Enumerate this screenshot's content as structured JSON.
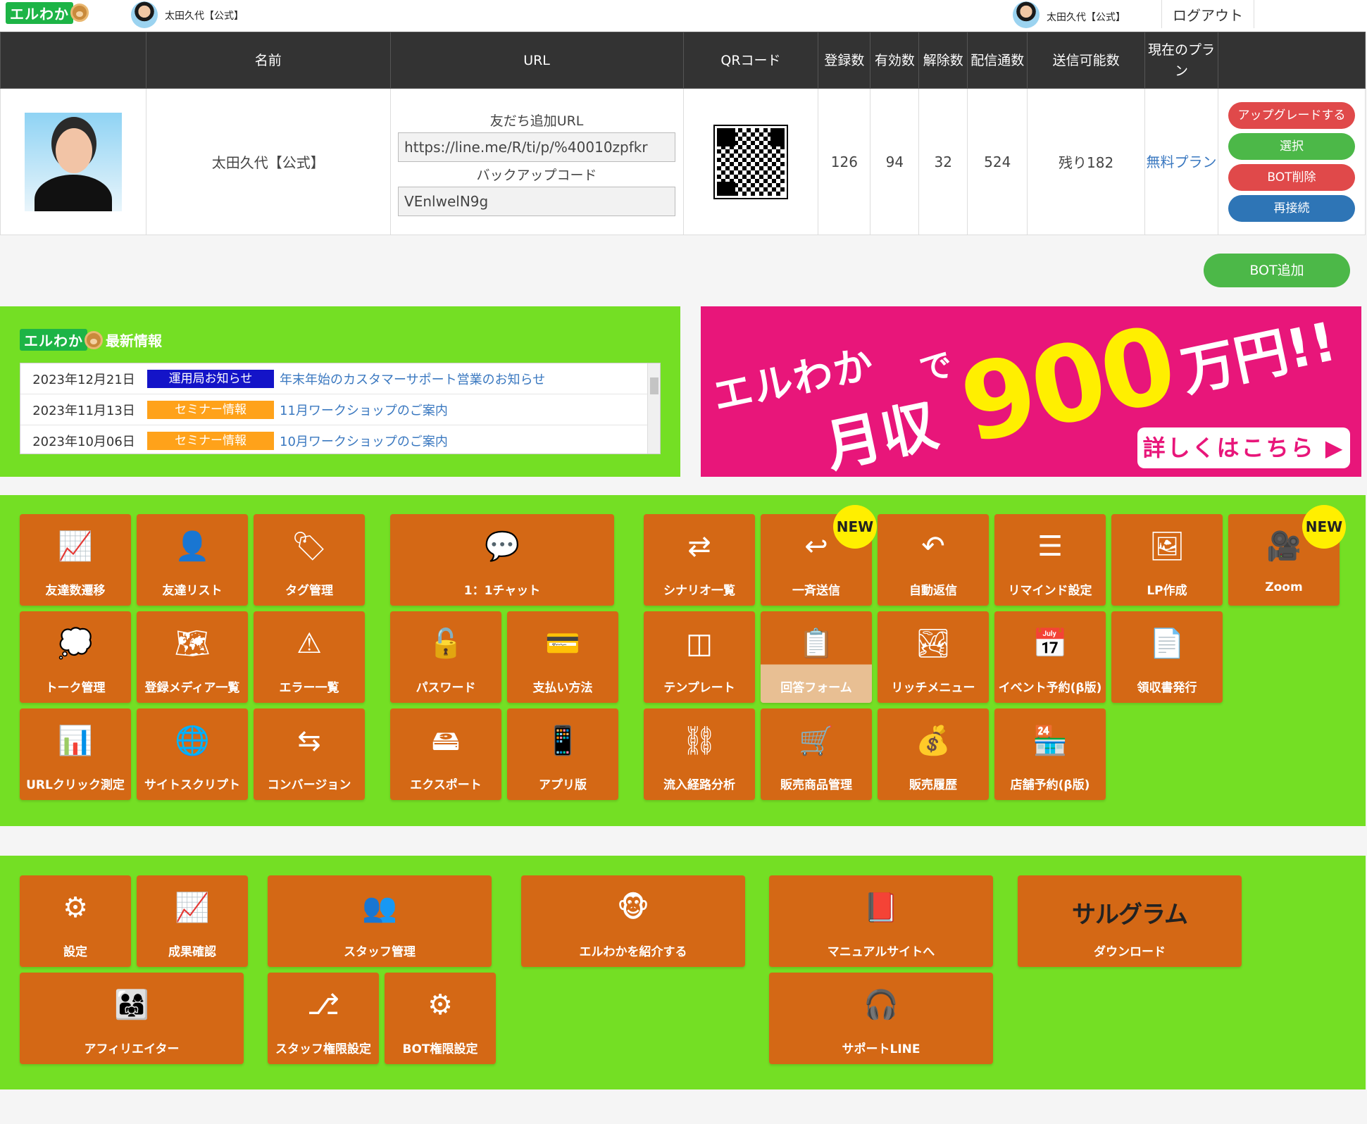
{
  "header": {
    "logo_text": "エルわか",
    "user_name_left": "太田久代【公式】",
    "user_name_right": "太田久代【公式】",
    "logout_label": "ログアウト"
  },
  "bot_table": {
    "headers": {
      "name": "名前",
      "url": "URL",
      "qr": "QRコード",
      "registered": "登録数",
      "active": "有効数",
      "cancelled": "解除数",
      "delivered": "配信通数",
      "sendable": "送信可能数",
      "plan": "現在のプラン"
    },
    "row": {
      "name": "太田久代【公式】",
      "friend_url_label": "友だち追加URL",
      "friend_url": "https://line.me/R/ti/p/%40010zpfkr",
      "backup_label": "バックアップコード",
      "backup_code": "VEnlwelN9g",
      "registered": "126",
      "active": "94",
      "cancelled": "32",
      "delivered": "524",
      "sendable": "残り182",
      "plan": "無料プラン"
    },
    "actions": {
      "upgrade": "アップグレードする",
      "select": "選択",
      "delete": "BOT削除",
      "reconnect": "再接続"
    }
  },
  "bot_add_label": "BOT追加",
  "news": {
    "title": "最新情報",
    "items": [
      {
        "date": "2023年12月21日",
        "badge": "運用局お知らせ",
        "badge_color": "#1414c8",
        "text": "年末年始のカスタマーサポート営業のお知らせ"
      },
      {
        "date": "2023年11月13日",
        "badge": "セミナー情報",
        "badge_color": "#ffa21a",
        "text": "11月ワークショップのご案内"
      },
      {
        "date": "2023年10月06日",
        "badge": "セミナー情報",
        "badge_color": "#ffa21a",
        "text": "10月ワークショップのご案内"
      }
    ]
  },
  "banner": {
    "a": "エルわか",
    "c": "で",
    "e": "月収",
    "n": "900",
    "m": "万円!!",
    "cta": "詳しくはこちら ▶"
  },
  "new_badge": "NEW",
  "menu": {
    "friend_trend": "友達数遷移",
    "friend_list": "友達リスト",
    "tag": "タグ管理",
    "chat": "1：1チャット",
    "scenario": "シナリオ一覧",
    "broadcast": "一斉送信",
    "auto_reply": "自動返信",
    "remind": "リマインド設定",
    "lp": "LP作成",
    "zoom": "Zoom",
    "talk": "トーク管理",
    "media": "登録メディア一覧",
    "error": "エラー一覧",
    "password": "パスワード",
    "payment": "支払い方法",
    "template": "テンプレート",
    "form": "回答フォーム",
    "rich_menu": "リッチメニュー",
    "event": "イベント予約(β版)",
    "receipt": "領収書発行",
    "url_click": "URLクリック測定",
    "site_script": "サイトスクリプト",
    "conversion": "コンバージョン",
    "export": "エクスポート",
    "app": "アプリ版",
    "inflow": "流入経路分析",
    "product": "販売商品管理",
    "sales": "販売履歴",
    "shop": "店舗予約(β版)"
  },
  "menu2": {
    "settings": "設定",
    "results": "成果確認",
    "staff": "スタッフ管理",
    "introduce": "エルわかを紹介する",
    "manual": "マニュアルサイトへ",
    "sarugram_logo": "サルグラム",
    "download": "ダウンロード",
    "affiliate": "アフィリエイター",
    "staff_perm": "スタッフ権限設定",
    "bot_perm": "BOT権限設定",
    "support": "サポートLINE"
  }
}
